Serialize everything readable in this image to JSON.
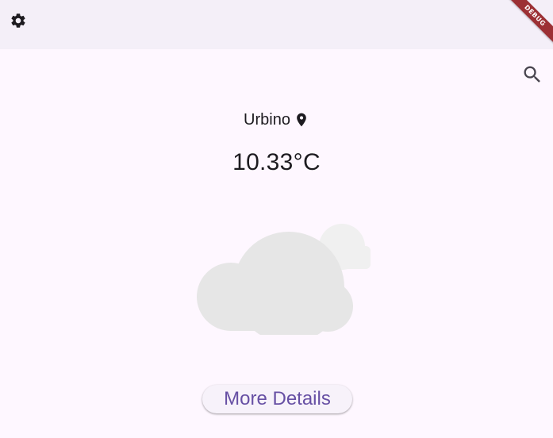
{
  "app_bar": {
    "settings_icon": "gear-icon",
    "debug_banner": "DEBUG"
  },
  "toolbar": {
    "search_icon": "search-icon"
  },
  "weather": {
    "city": "Urbino",
    "location_icon": "location-pin-icon",
    "temperature": "10.33°C",
    "condition_icon": "cloud-icon"
  },
  "actions": {
    "more_details_label": "More Details"
  },
  "colors": {
    "background": "#fef7ff",
    "app_bar": "#f4eff8",
    "primary": "#6750a4",
    "text": "#1d1b20",
    "cloud": "#e6e6e6",
    "cloud_light": "#f0f0f0",
    "debug_banner": "#9c3034"
  }
}
